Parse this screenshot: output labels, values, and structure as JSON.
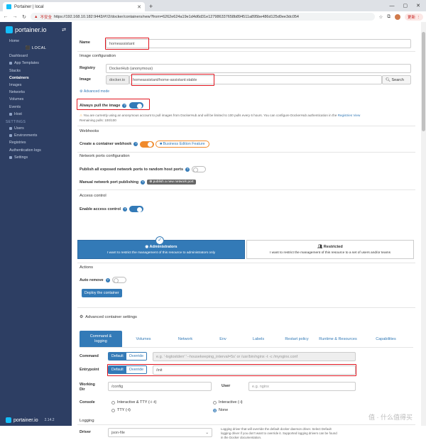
{
  "browser": {
    "tab_title": "Portainer | local",
    "insecure_label": "不安全",
    "url": "https://192.168.10.182:9443/#!/2/docker/containers/new?from=6262e624a19e1d4d6d31e127986337658b894511a895be486d125d0ee3dc054",
    "update_label": "更新 ⋮"
  },
  "sidebar": {
    "brand": "portainer.io",
    "endpoint": "LOCAL",
    "items": [
      "Home",
      "Dashboard",
      "App Templates",
      "Stacks",
      "Containers",
      "Images",
      "Networks",
      "Volumes",
      "Events",
      "Host"
    ],
    "settings_header": "SETTINGS",
    "settings_items": [
      "Users",
      "Environments",
      "Registries",
      "Authentication logs",
      "Settings"
    ],
    "footer_brand": "portainer.io",
    "version": "2.14.2"
  },
  "form": {
    "name_label": "Name",
    "name_value": "homeassistant",
    "image_config_title": "Image configuration",
    "registry_label": "Registry",
    "registry_value": "DockerHub (anonymous)",
    "image_label": "Image",
    "image_prefix": "docker.io",
    "image_value": "homeassistant/home-assistant:stable",
    "search_label": "Search",
    "advanced_mode": "Advanced mode",
    "always_pull_label": "Always pull the image",
    "notice": "You are currently using an anonymous account to pull images from DockerHub and will be limited to 100 pulls every 6 hours. You can configure DockerHub authentication in the",
    "notice_link": "Registries View",
    "remaining": "Remaining pulls: 100/100",
    "webhooks_title": "Webhooks",
    "webhook_label": "Create a container webhook",
    "business_label": "Business Edition Feature",
    "ports_title": "Network ports configuration",
    "publish_all_label": "Publish all exposed network ports to random host ports",
    "manual_port_label": "Manual network port publishing",
    "publish_btn": "publish a new network port",
    "access_title": "Access control",
    "enable_access_label": "Enable access control",
    "admins_title": "Administrators",
    "admins_desc": "I want to restrict the management of this resource to administrators only",
    "restricted_title": "Restricted",
    "restricted_desc": "I want to restrict the management of this resource to a set of users and/or teams",
    "actions_title": "Actions",
    "auto_remove_label": "Auto remove",
    "deploy_btn": "Deploy the container",
    "advanced_title": "Advanced container settings",
    "tabs": [
      "Command & logging",
      "Volumes",
      "Network",
      "Env",
      "Labels",
      "Restart policy",
      "Runtime & Resources",
      "Capabilities"
    ],
    "command_label": "Command",
    "default_label": "Default",
    "override_label": "Override",
    "command_placeholder": "e.g. '-logtostderr' '--housekeeping_interval=5s' or /usr/bin/nginx -t -c /mynginx.conf",
    "entrypoint_label": "Entrypoint",
    "entrypoint_value": "/init",
    "workdir_label": "Working Dir",
    "workdir_value": "/config",
    "user_label": "User",
    "user_placeholder": "e.g. nginx",
    "console_label": "Console",
    "console_opts": [
      "Interactive & TTY (-i -t)",
      "TTY (-t)",
      "Interactive (-i)",
      "None"
    ],
    "logging_title": "Logging",
    "driver_label": "Driver",
    "driver_value": "json-file",
    "driver_help": "Logging driver that will override the default docker daemon driver. Select Default logging driver if you don't want to override it. Supported logging drivers can be found in the Docker documentation."
  },
  "watermark": "值 · 什么值得买",
  "colors": {
    "sidebar": "#2d3e63",
    "accent": "#337ab7",
    "highlight": "#e0141e",
    "orange": "#f08a2c"
  }
}
